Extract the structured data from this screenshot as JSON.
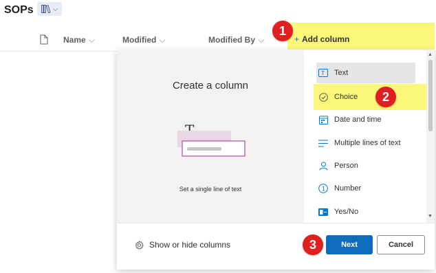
{
  "library": {
    "title": "SOPs"
  },
  "columns": {
    "name": "Name",
    "modified": "Modified",
    "modified_by": "Modified By",
    "add_column": "Add column"
  },
  "panel": {
    "title": "Create a column",
    "preview_desc": "Set a single line of text",
    "types": [
      {
        "label": "Text",
        "icon": "text-field-icon"
      },
      {
        "label": "Choice",
        "icon": "choice-check-icon"
      },
      {
        "label": "Date and time",
        "icon": "calendar-icon"
      },
      {
        "label": "Multiple lines of text",
        "icon": "multiline-icon"
      },
      {
        "label": "Person",
        "icon": "person-icon"
      },
      {
        "label": "Number",
        "icon": "number-icon"
      },
      {
        "label": "Yes/No",
        "icon": "yes-no-icon"
      }
    ],
    "show_hide": "Show or hide columns",
    "next": "Next",
    "cancel": "Cancel"
  },
  "badges": [
    "1",
    "2",
    "3"
  ],
  "colors": {
    "highlight": "#fbf77a",
    "badge": "#e02020",
    "primary": "#0f6cbd"
  }
}
